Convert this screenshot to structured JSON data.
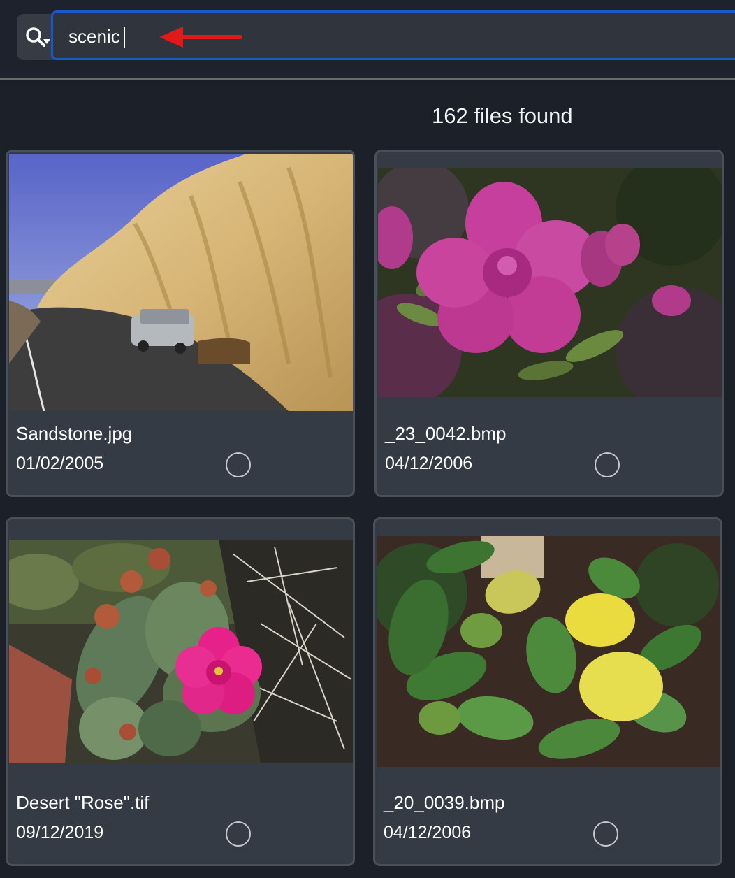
{
  "search": {
    "value": "scenic",
    "icon": "magnifier-dropdown-icon",
    "accent": "#1a5ac8"
  },
  "annotation": {
    "arrow_color": "#e11919"
  },
  "results": {
    "count_text": "162 files found"
  },
  "files": [
    {
      "name": "Sandstone.jpg",
      "date": "01/02/2005",
      "image": "sandstone-cliff-road-car"
    },
    {
      "name": "_23_0042.bmp",
      "date": "04/12/2006",
      "image": "pink-azalea-flower"
    },
    {
      "name": "Desert \"Rose\".tif",
      "date": "09/12/2019",
      "image": "cactus-with-pink-flower"
    },
    {
      "name": "_20_0039.bmp",
      "date": "04/12/2006",
      "image": "lemon-tree"
    }
  ]
}
